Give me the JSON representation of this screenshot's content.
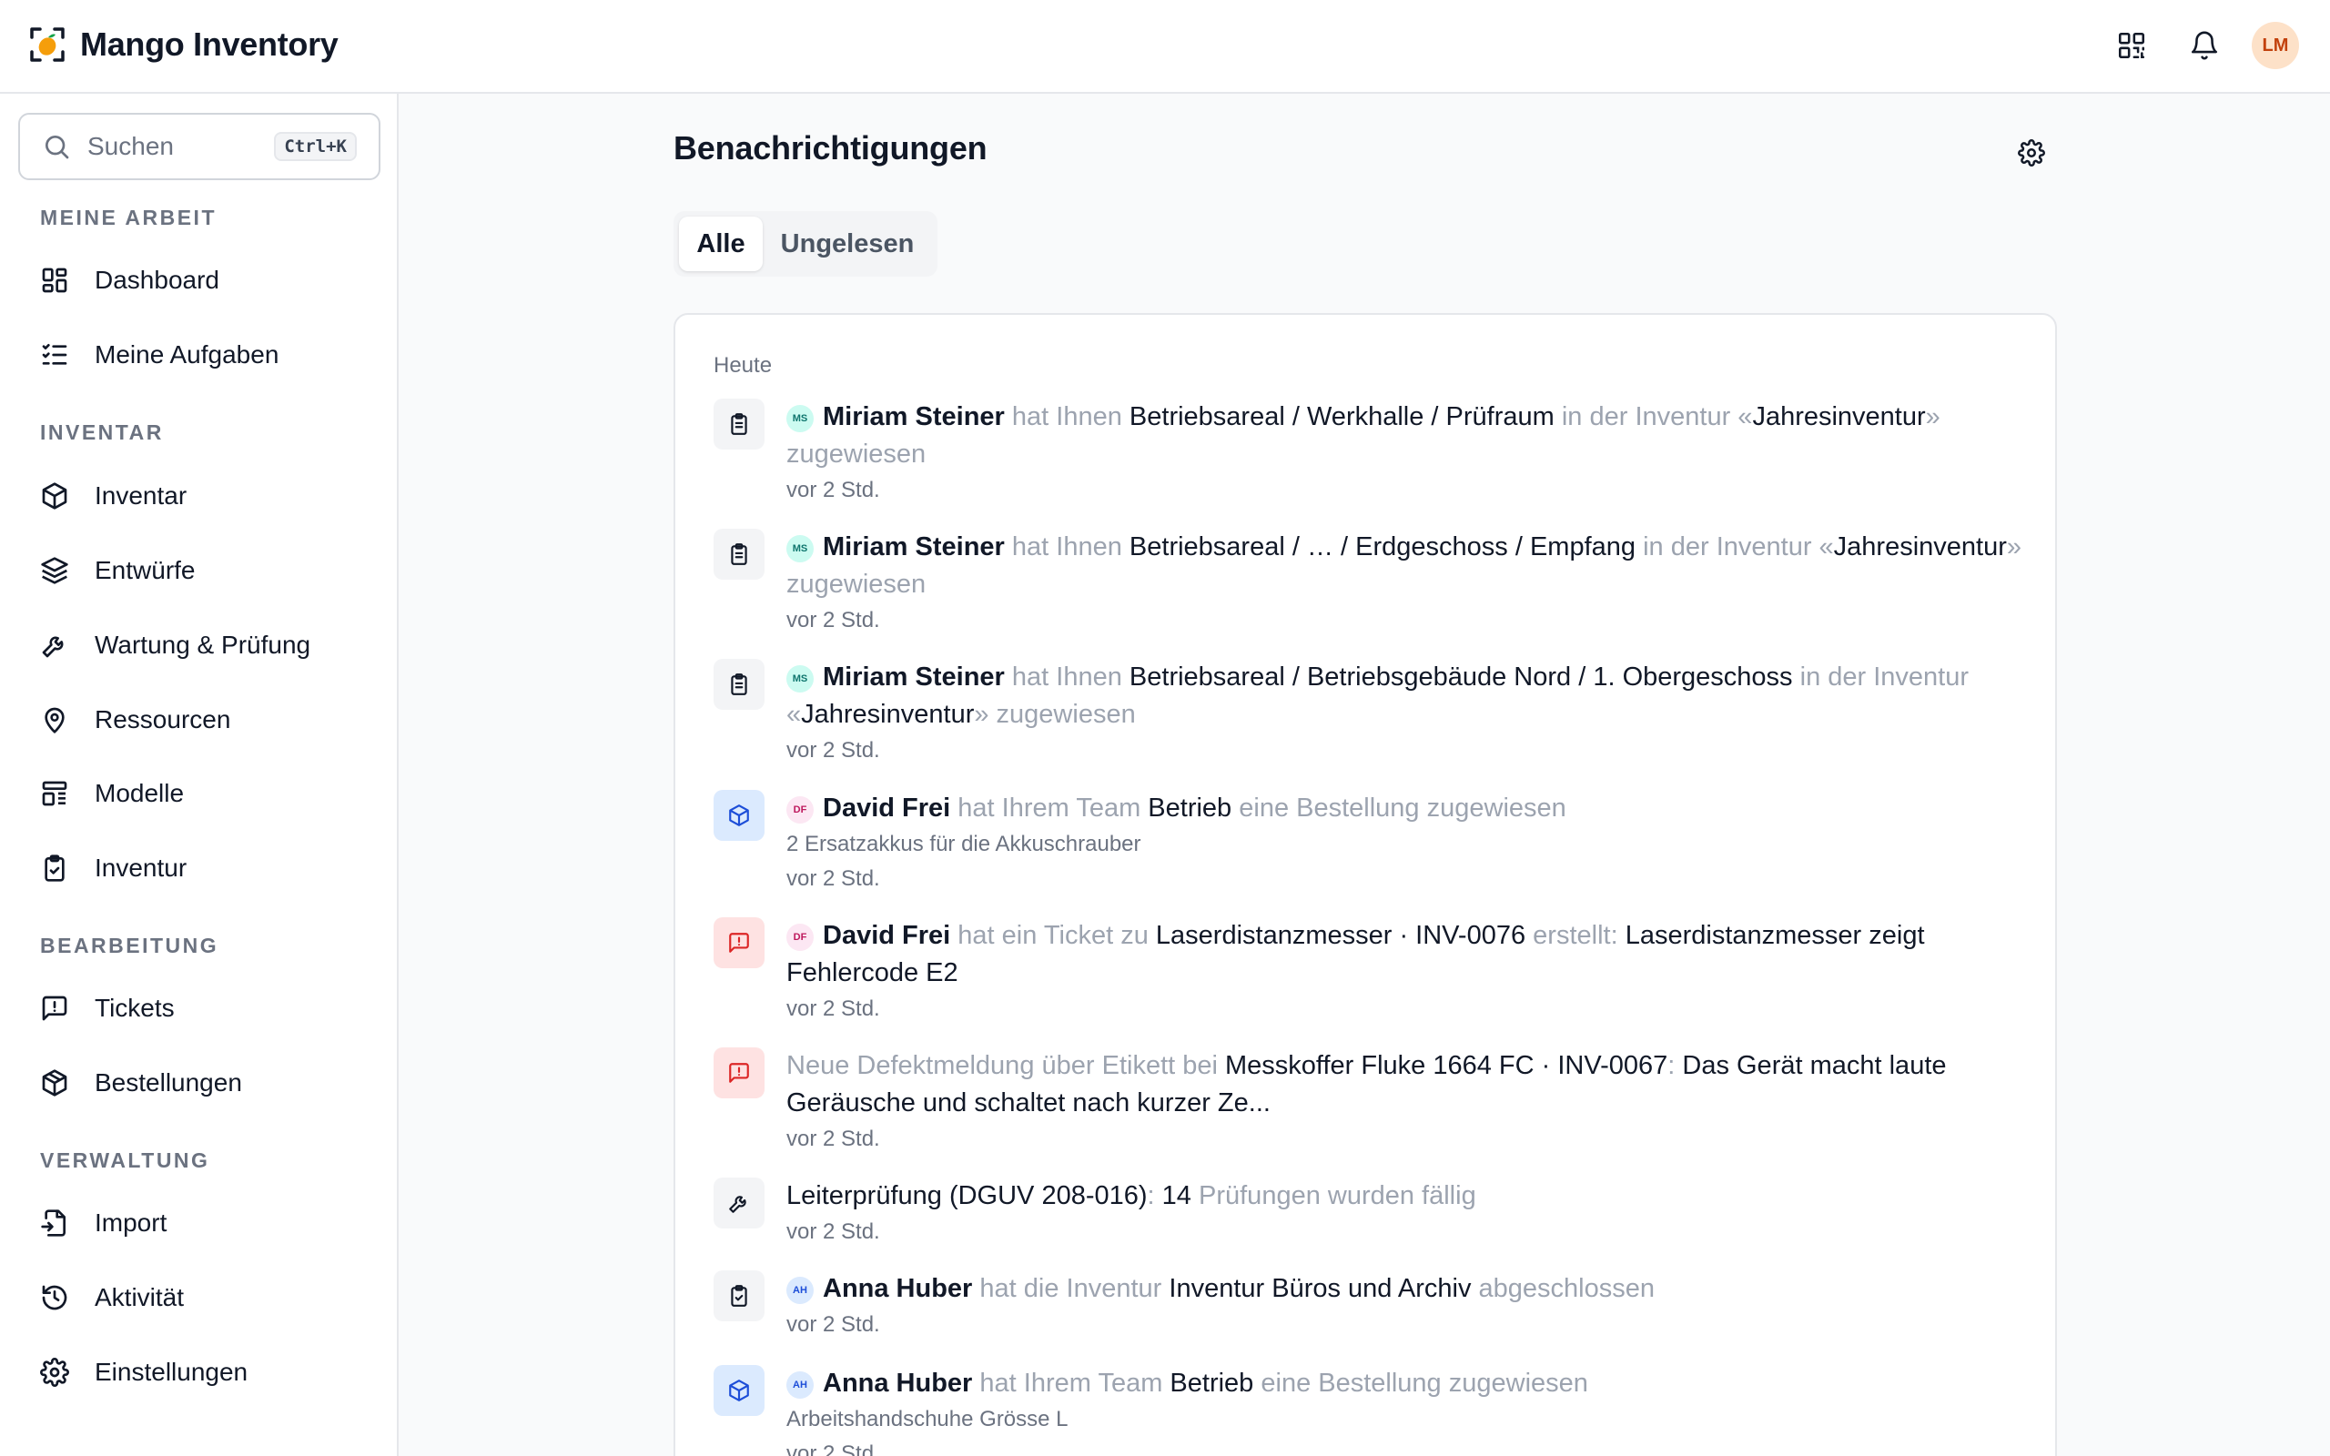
{
  "app": {
    "name": "Mango Inventory"
  },
  "header": {
    "avatar_initials": "LM"
  },
  "sidebar": {
    "search_placeholder": "Suchen",
    "search_shortcut": "Ctrl+K",
    "sections": {
      "meine_arbeit": "MEINE ARBEIT",
      "inventar": "INVENTAR",
      "bearbeitung": "BEARBEITUNG",
      "verwaltung": "VERWALTUNG"
    },
    "items": {
      "dashboard": "Dashboard",
      "aufgaben": "Meine Aufgaben",
      "inventar": "Inventar",
      "entwuerfe": "Entwürfe",
      "wartung": "Wartung & Prüfung",
      "ressourcen": "Ressourcen",
      "modelle": "Modelle",
      "inventur": "Inventur",
      "tickets": "Tickets",
      "bestellungen": "Bestellungen",
      "import": "Import",
      "aktivitaet": "Aktivität",
      "einstellungen": "Einstellungen"
    }
  },
  "main": {
    "title": "Benachrichtigungen",
    "tabs": {
      "all": "Alle",
      "unread": "Ungelesen"
    },
    "group_today": "Heute",
    "notifications": [
      {
        "avatar": "MS",
        "actor": "Miriam Steiner",
        "t1": "hat Ihnen",
        "target": "Betriebsareal / Werkhalle / Prüfraum",
        "t2": "in der Inventur «",
        "inventory": "Jahresinventur",
        "t3": "» zugewiesen",
        "time": "vor 2 Std."
      },
      {
        "avatar": "MS",
        "actor": "Miriam Steiner",
        "t1": "hat Ihnen",
        "target": "Betriebsareal / … / Erdgeschoss / Empfang",
        "t2": "in der Inventur «",
        "inventory": "Jahresinventur",
        "t3": "» zugewiesen",
        "time": "vor 2 Std."
      },
      {
        "avatar": "MS",
        "actor": "Miriam Steiner",
        "t1": "hat Ihnen",
        "target": "Betriebsareal / Betriebsgebäude Nord / 1. Obergeschoss",
        "t2": "in der Inventur «",
        "inventory": "Jahresinventur",
        "t3": "» zugewiesen",
        "time": "vor 2 Std."
      },
      {
        "avatar": "DF",
        "actor": "David Frei",
        "t1": "hat Ihrem Team",
        "target": "Betrieb",
        "t2": "eine Bestellung zugewiesen",
        "sub": "2 Ersatzakkus für die Akkuschrauber",
        "time": "vor 2 Std."
      },
      {
        "avatar": "DF",
        "actor": "David Frei",
        "t1": "hat ein Ticket zu",
        "target": "Laserdistanzmesser · INV-0076",
        "t2": "erstellt:",
        "detail": "Laserdistanzmesser zeigt Fehlercode E2",
        "time": "vor 2 Std."
      },
      {
        "t1": "Neue Defektmeldung über Etikett bei",
        "target": "Messkoffer Fluke 1664 FC · INV-0067",
        "t2": ":",
        "detail": "Das Gerät macht laute Geräusche und schaltet nach kurzer Ze...",
        "time": "vor 2 Std."
      },
      {
        "target": "Leiterprüfung (DGUV 208-016)",
        "t1": ":",
        "count": "14",
        "t2": "Prüfungen wurden fällig",
        "time": "vor 2 Std."
      },
      {
        "avatar": "AH",
        "actor": "Anna Huber",
        "t1": "hat die Inventur",
        "target": "Inventur Büros und Archiv",
        "t2": "abgeschlossen",
        "time": "vor 2 Std."
      },
      {
        "avatar": "AH",
        "actor": "Anna Huber",
        "t1": "hat Ihrem Team",
        "target": "Betrieb",
        "t2": "eine Bestellung zugewiesen",
        "sub": "Arbeitshandschuhe Grösse L",
        "time": "vor 2 Std."
      }
    ]
  },
  "colors": {
    "brand_orange": "#f59e0b",
    "badge_blue": "#dbeafe",
    "badge_red": "#fee2e2"
  }
}
